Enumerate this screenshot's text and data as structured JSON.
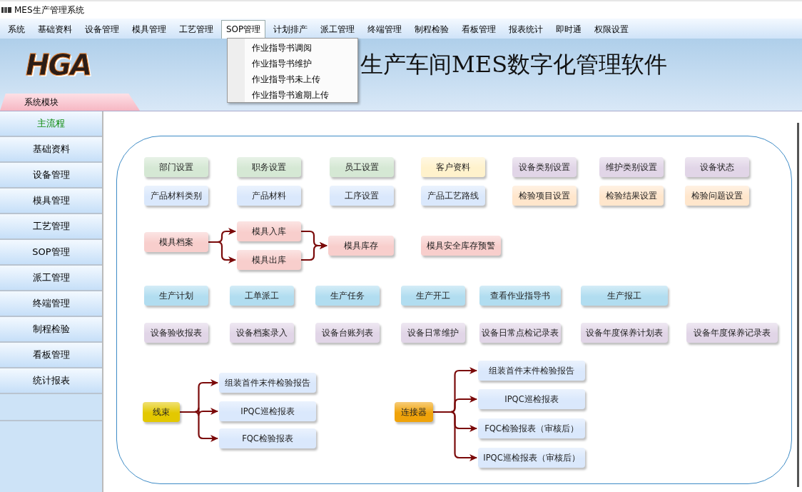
{
  "window": {
    "title": "MES生产管理系统"
  },
  "menu": [
    {
      "label": "系统",
      "selected": false
    },
    {
      "label": "基础资料",
      "selected": false
    },
    {
      "label": "设备管理",
      "selected": false
    },
    {
      "label": "模具管理",
      "selected": false
    },
    {
      "label": "工艺管理",
      "selected": false
    },
    {
      "label": "SOP管理",
      "selected": true
    },
    {
      "label": "计划排产",
      "selected": false
    },
    {
      "label": "派工管理",
      "selected": false
    },
    {
      "label": "终端管理",
      "selected": false
    },
    {
      "label": "制程检验",
      "selected": false
    },
    {
      "label": "看板管理",
      "selected": false
    },
    {
      "label": "报表统计",
      "selected": false
    },
    {
      "label": "即时通",
      "selected": false
    },
    {
      "label": "权限设置",
      "selected": false
    }
  ],
  "dropdown": {
    "items": [
      "作业指导书调阅",
      "作业指导书维护",
      "作业指导书未上传",
      "作业指导书逾期上传"
    ]
  },
  "banner": {
    "logo": "HGA",
    "title": "生产车间MES数字化管理软件"
  },
  "module_tab": {
    "label": "系统模块"
  },
  "sidebar": {
    "items": [
      {
        "label": "主流程",
        "selected": true
      },
      {
        "label": "基础资料",
        "selected": false
      },
      {
        "label": "设备管理",
        "selected": false
      },
      {
        "label": "模具管理",
        "selected": false
      },
      {
        "label": "工艺管理",
        "selected": false
      },
      {
        "label": "SOP管理",
        "selected": false
      },
      {
        "label": "派工管理",
        "selected": false
      },
      {
        "label": "终端管理",
        "selected": false
      },
      {
        "label": "制程检验",
        "selected": false
      },
      {
        "label": "看板管理",
        "selected": false
      },
      {
        "label": "统计报表",
        "selected": false
      }
    ]
  },
  "diagram": {
    "setup_rows": [
      [
        {
          "label": "部门设置",
          "color": "#d5e8d4"
        },
        {
          "label": "职务设置",
          "color": "#d5e8d4"
        },
        {
          "label": "员工设置",
          "color": "#d5e8d4"
        },
        {
          "label": "客户资料",
          "color": "#fff2cc"
        },
        {
          "label": "设备类别设置",
          "color": "#e1d5e7"
        },
        {
          "label": "维护类别设置",
          "color": "#e1d5e7"
        },
        {
          "label": "设备状态",
          "color": "#e1d5e7"
        }
      ],
      [
        {
          "label": "产品材料类别",
          "color": "#dae8fc"
        },
        {
          "label": "产品材料",
          "color": "#dae8fc"
        },
        {
          "label": "工序设置",
          "color": "#dae8fc"
        },
        {
          "label": "产品工艺路线",
          "color": "#dae8fc"
        },
        {
          "label": "检验项目设置",
          "color": "#ffe6cc"
        },
        {
          "label": "检验结果设置",
          "color": "#ffe6cc"
        },
        {
          "label": "检验问题设置",
          "color": "#ffe6cc"
        }
      ]
    ],
    "mold_flow": [
      {
        "label": "模具档案",
        "color": "#f8cecc"
      },
      {
        "label": "模具入库",
        "color": "#f8cecc"
      },
      {
        "label": "模具出库",
        "color": "#f8cecc"
      },
      {
        "label": "模具库存",
        "color": "#f8cecc"
      },
      {
        "label": "模具安全库存预警",
        "color": "#f8cecc"
      }
    ],
    "work_rows": [
      [
        {
          "label": "生产计划",
          "color": "#b1ddf0"
        },
        {
          "label": "工单派工",
          "color": "#b1ddf0"
        },
        {
          "label": "生产任务",
          "color": "#b1ddf0"
        },
        {
          "label": "生产开工",
          "color": "#b1ddf0"
        },
        {
          "label": "查看作业指导书",
          "color": "#b1ddf0"
        },
        {
          "label": "生产报工",
          "color": "#b1ddf0"
        }
      ],
      [
        {
          "label": "设备验收报表",
          "color": "#e1d5e7"
        },
        {
          "label": "设备档案录入",
          "color": "#e1d5e7"
        },
        {
          "label": "设备台账列表",
          "color": "#e1d5e7"
        },
        {
          "label": "设备日常维护",
          "color": "#e1d5e7"
        },
        {
          "label": "设备日常点检记录表",
          "color": "#e1d5e7"
        },
        {
          "label": "设备年度保养计划表",
          "color": "#e1d5e7"
        },
        {
          "label": "设备年度保养记录表",
          "color": "#e1d5e7"
        }
      ]
    ],
    "branches": [
      {
        "root": {
          "label": "线束",
          "color": "#e3c800"
        },
        "children": [
          {
            "label": "组装首件末件检验报告",
            "color": "#dae8fc"
          },
          {
            "label": "IPQC巡检报表",
            "color": "#dae8fc"
          },
          {
            "label": "FQC检验报表",
            "color": "#dae8fc"
          }
        ]
      },
      {
        "root": {
          "label": "连接器",
          "color": "#f0a30a"
        },
        "children": [
          {
            "label": "组装首件末件检验报告",
            "color": "#dae8fc"
          },
          {
            "label": "IPQC巡检报表",
            "color": "#dae8fc"
          },
          {
            "label": "FQC检验报表（审核后）",
            "color": "#dae8fc"
          },
          {
            "label": "IPQC巡检报表（审核后）",
            "color": "#dae8fc"
          }
        ]
      }
    ]
  }
}
